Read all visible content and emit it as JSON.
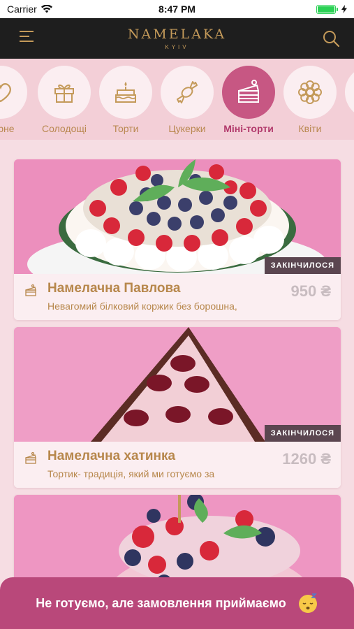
{
  "status_bar": {
    "carrier": "Carrier",
    "time": "8:47 PM",
    "wifi_icon": "wifi-icon",
    "battery_icon": "battery-icon",
    "charging_icon": "bolt-icon"
  },
  "header": {
    "brand": "NAMELAKA",
    "city": "KYIV",
    "menu_icon": "hamburger-menu-icon",
    "search_icon": "search-icon",
    "accent_color": "#c49a5a"
  },
  "categories": [
    {
      "label": "лярне",
      "icon": "heart-icon",
      "active": false
    },
    {
      "label": "Солодощі",
      "icon": "gift-icon",
      "active": false
    },
    {
      "label": "Торти",
      "icon": "cake-icon",
      "active": false
    },
    {
      "label": "Цукерки",
      "icon": "candy-icon",
      "active": false
    },
    {
      "label": "Міні-торти",
      "icon": "cake-slice-icon",
      "active": true
    },
    {
      "label": "Квіти",
      "icon": "flower-icon",
      "active": false
    }
  ],
  "products": [
    {
      "title": "Намелачна Павлова",
      "description": "Невагомий білковий коржик без борошна,",
      "price": "950 ₴",
      "badge": "ЗАКІНЧИЛОСЯ",
      "image": "pavlova-cake-photo"
    },
    {
      "title": "Намелачна хатинка",
      "description": "Тортик- традиція, який ми готуємо за",
      "price": "1260 ₴",
      "badge": "ЗАКІНЧИЛОСЯ",
      "image": "chocolate-house-cake-photo"
    },
    {
      "title": "",
      "description": "",
      "price": "",
      "badge": "",
      "image": "berry-cake-photo"
    }
  ],
  "banner": {
    "text": "Не готуємо, але замовлення приймаємо",
    "emoji_icon": "sleeping-face-icon",
    "color": "#b9487a"
  }
}
